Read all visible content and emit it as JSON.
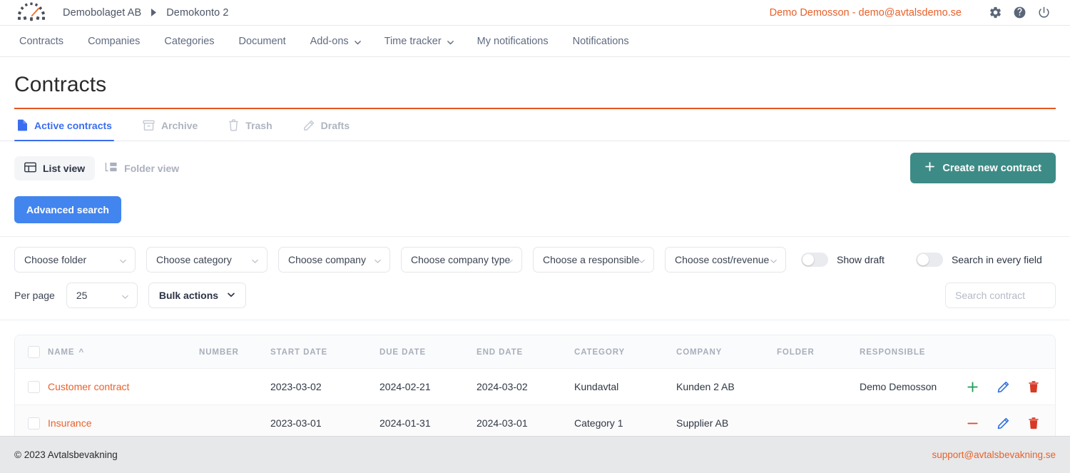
{
  "topbar": {
    "logo_name": "avtalsbevakning-gauge-logo",
    "breadcrumb": {
      "company": "Demobolaget AB",
      "account": "Demokonto 2"
    },
    "user": "Demo Demosson - demo@avtalsdemo.se",
    "icons": [
      "gear-icon",
      "help-icon",
      "power-icon"
    ]
  },
  "nav": {
    "items": [
      {
        "label": "Contracts",
        "caret": false
      },
      {
        "label": "Companies",
        "caret": false
      },
      {
        "label": "Categories",
        "caret": false
      },
      {
        "label": "Document",
        "caret": false
      },
      {
        "label": "Add-ons",
        "caret": true
      },
      {
        "label": "Time tracker",
        "caret": true
      },
      {
        "label": "My notifications",
        "caret": false
      },
      {
        "label": "Notifications",
        "caret": false
      }
    ]
  },
  "page": {
    "title": "Contracts"
  },
  "tabs": [
    {
      "label": "Active contracts",
      "icon": "document-icon",
      "active": true
    },
    {
      "label": "Archive",
      "icon": "archive-box-icon",
      "active": false
    },
    {
      "label": "Trash",
      "icon": "trash-icon",
      "active": false
    },
    {
      "label": "Drafts",
      "icon": "pencil-icon",
      "active": false
    }
  ],
  "viewrow": {
    "list_view": "List view",
    "folder_view": "Folder view",
    "create_button": "Create new contract"
  },
  "advanced_search": {
    "label": "Advanced search"
  },
  "filters": {
    "folder": "Choose folder",
    "category": "Choose category",
    "company": "Choose company",
    "company_type": "Choose company type",
    "responsible": "Choose a responsible",
    "cost_revenue": "Choose cost/revenue",
    "show_draft": "Show draft",
    "show_draft_on": false,
    "search_every_field": "Search in every field",
    "search_every_field_on": false,
    "per_page_label": "Per page",
    "per_page_value": "25",
    "bulk_actions": "Bulk actions",
    "search_placeholder": "Search contract",
    "search_value": ""
  },
  "table": {
    "columns": [
      "NAME",
      "NUMBER",
      "START DATE",
      "DUE DATE",
      "END DATE",
      "CATEGORY",
      "COMPANY",
      "FOLDER",
      "RESPONSIBLE"
    ],
    "sorted_column": "NAME",
    "sort_direction": "asc",
    "rows": [
      {
        "name": "Customer contract",
        "number": "",
        "start_date": "2023-03-02",
        "due_date": "2024-02-21",
        "end_date": "2024-03-02",
        "category": "Kundavtal",
        "company": "Kunden 2 AB",
        "folder": "",
        "responsible": "Demo Demosson",
        "expand_icon": "plus-icon",
        "expand_color": "#1f9d55"
      },
      {
        "name": "Insurance",
        "number": "",
        "start_date": "2023-03-01",
        "due_date": "2024-01-31",
        "end_date": "2024-03-01",
        "category": "Category 1",
        "company": "Supplier AB",
        "folder": "",
        "responsible": "",
        "expand_icon": "minus-icon",
        "expand_color": "#e0462c"
      }
    ]
  },
  "footer": {
    "copyright": "© 2023 Avtalsbevakning",
    "support": "support@avtalsbevakning.se"
  },
  "colors": {
    "accent_orange": "#e8612a",
    "link_blue": "#3a6df0",
    "primary_blue": "#4285ef",
    "teal": "#3d8b86",
    "green": "#1f9d55",
    "red": "#e0462c"
  }
}
